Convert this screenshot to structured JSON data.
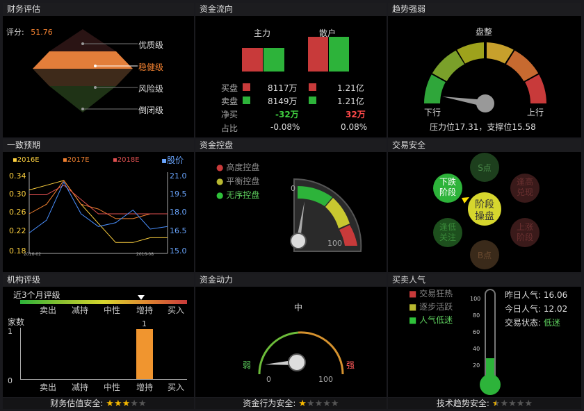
{
  "panels": {
    "finance": {
      "title": "财务评估",
      "score_label": "评分:",
      "score_value": "51.76",
      "levels": [
        "优质级",
        "稳健级",
        "风险级",
        "倒闭级"
      ]
    },
    "flow": {
      "title": "资金流向",
      "col_main": "主力",
      "col_retail": "散户",
      "rows": [
        {
          "label": "买盘",
          "main": "8117万",
          "retail": "1.21亿"
        },
        {
          "label": "卖盘",
          "main": "8149万",
          "retail": "1.21亿"
        },
        {
          "label": "净买",
          "main": "-32万",
          "retail": "32万"
        },
        {
          "label": "占比",
          "main": "-0.08%",
          "retail": "0.08%"
        }
      ]
    },
    "trend": {
      "title": "趋势强弱",
      "state": "盘整",
      "left_label": "下行",
      "right_label": "上行",
      "note": "压力位17.31，支撑位15.58"
    },
    "forecast": {
      "title": "一致预期",
      "legend": [
        "2016E",
        "2017E",
        "2018E",
        "股价"
      ],
      "y_left": [
        "0.34",
        "0.30",
        "0.26",
        "0.22",
        "0.18"
      ],
      "y_right": [
        "21.0",
        "19.5",
        "18.0",
        "16.5",
        "15.0"
      ],
      "x_labels": [
        "2016-02",
        "2016-08"
      ]
    },
    "control": {
      "title": "资金控盘",
      "items": [
        "高度控盘",
        "平衡控盘",
        "无序控盘"
      ],
      "g_min": "0",
      "g_max": "100"
    },
    "safety": {
      "title": "交易安全",
      "center": "阶段\n操盘",
      "nodes": [
        "S点",
        "逢高\n兑现",
        "上涨\n阶段",
        "B点",
        "逢低\n关注",
        "下跌\n阶段"
      ]
    },
    "rating": {
      "title": "机构评级",
      "subtitle": "近3个月评级",
      "scale": [
        "卖出",
        "减持",
        "中性",
        "增持",
        "买入"
      ],
      "ylabel": "家数",
      "y_max": "1",
      "y_min": "0",
      "bar_label": "1"
    },
    "power": {
      "title": "资金动力",
      "mid": "中",
      "weak": "弱",
      "strong": "强",
      "min": "0",
      "max": "100"
    },
    "popularity": {
      "title": "买卖人气",
      "legend": [
        "交易狂热",
        "逐步活跃",
        "人气低迷"
      ],
      "ticks": [
        "100",
        "80",
        "60",
        "40",
        "20"
      ],
      "stats": [
        {
          "k": "昨日人气:",
          "v": "16.06"
        },
        {
          "k": "今日人气:",
          "v": "12.02"
        },
        {
          "k": "交易状态:",
          "v": "低迷"
        }
      ]
    }
  },
  "footers": [
    {
      "label": "财务估值安全:",
      "stars": 3
    },
    {
      "label": "资金行为安全:",
      "stars": 1
    },
    {
      "label": "技术趋势安全:",
      "stars": 0.5
    }
  ],
  "chart_data": {
    "type": "line",
    "series": [
      {
        "name": "2016E",
        "values": [
          0.31,
          0.32,
          0.33,
          0.28,
          0.24,
          0.2,
          0.2,
          0.21,
          0.21
        ]
      },
      {
        "name": "2017E",
        "values": [
          0.26,
          0.28,
          0.33,
          0.28,
          0.27,
          0.25,
          0.25,
          0.26,
          0.26
        ]
      },
      {
        "name": "2018E",
        "values": [
          0.3,
          0.3,
          0.32,
          0.29,
          0.26,
          0.26,
          0.26,
          0.26,
          0.26
        ]
      },
      {
        "name": "股价",
        "values": [
          16.5,
          17.5,
          20.5,
          18.0,
          17.0,
          17.3,
          18.3,
          16.8,
          17.0
        ]
      }
    ],
    "ylim": [
      0.18,
      0.34
    ],
    "ylim_right": [
      15.0,
      21.0
    ]
  }
}
